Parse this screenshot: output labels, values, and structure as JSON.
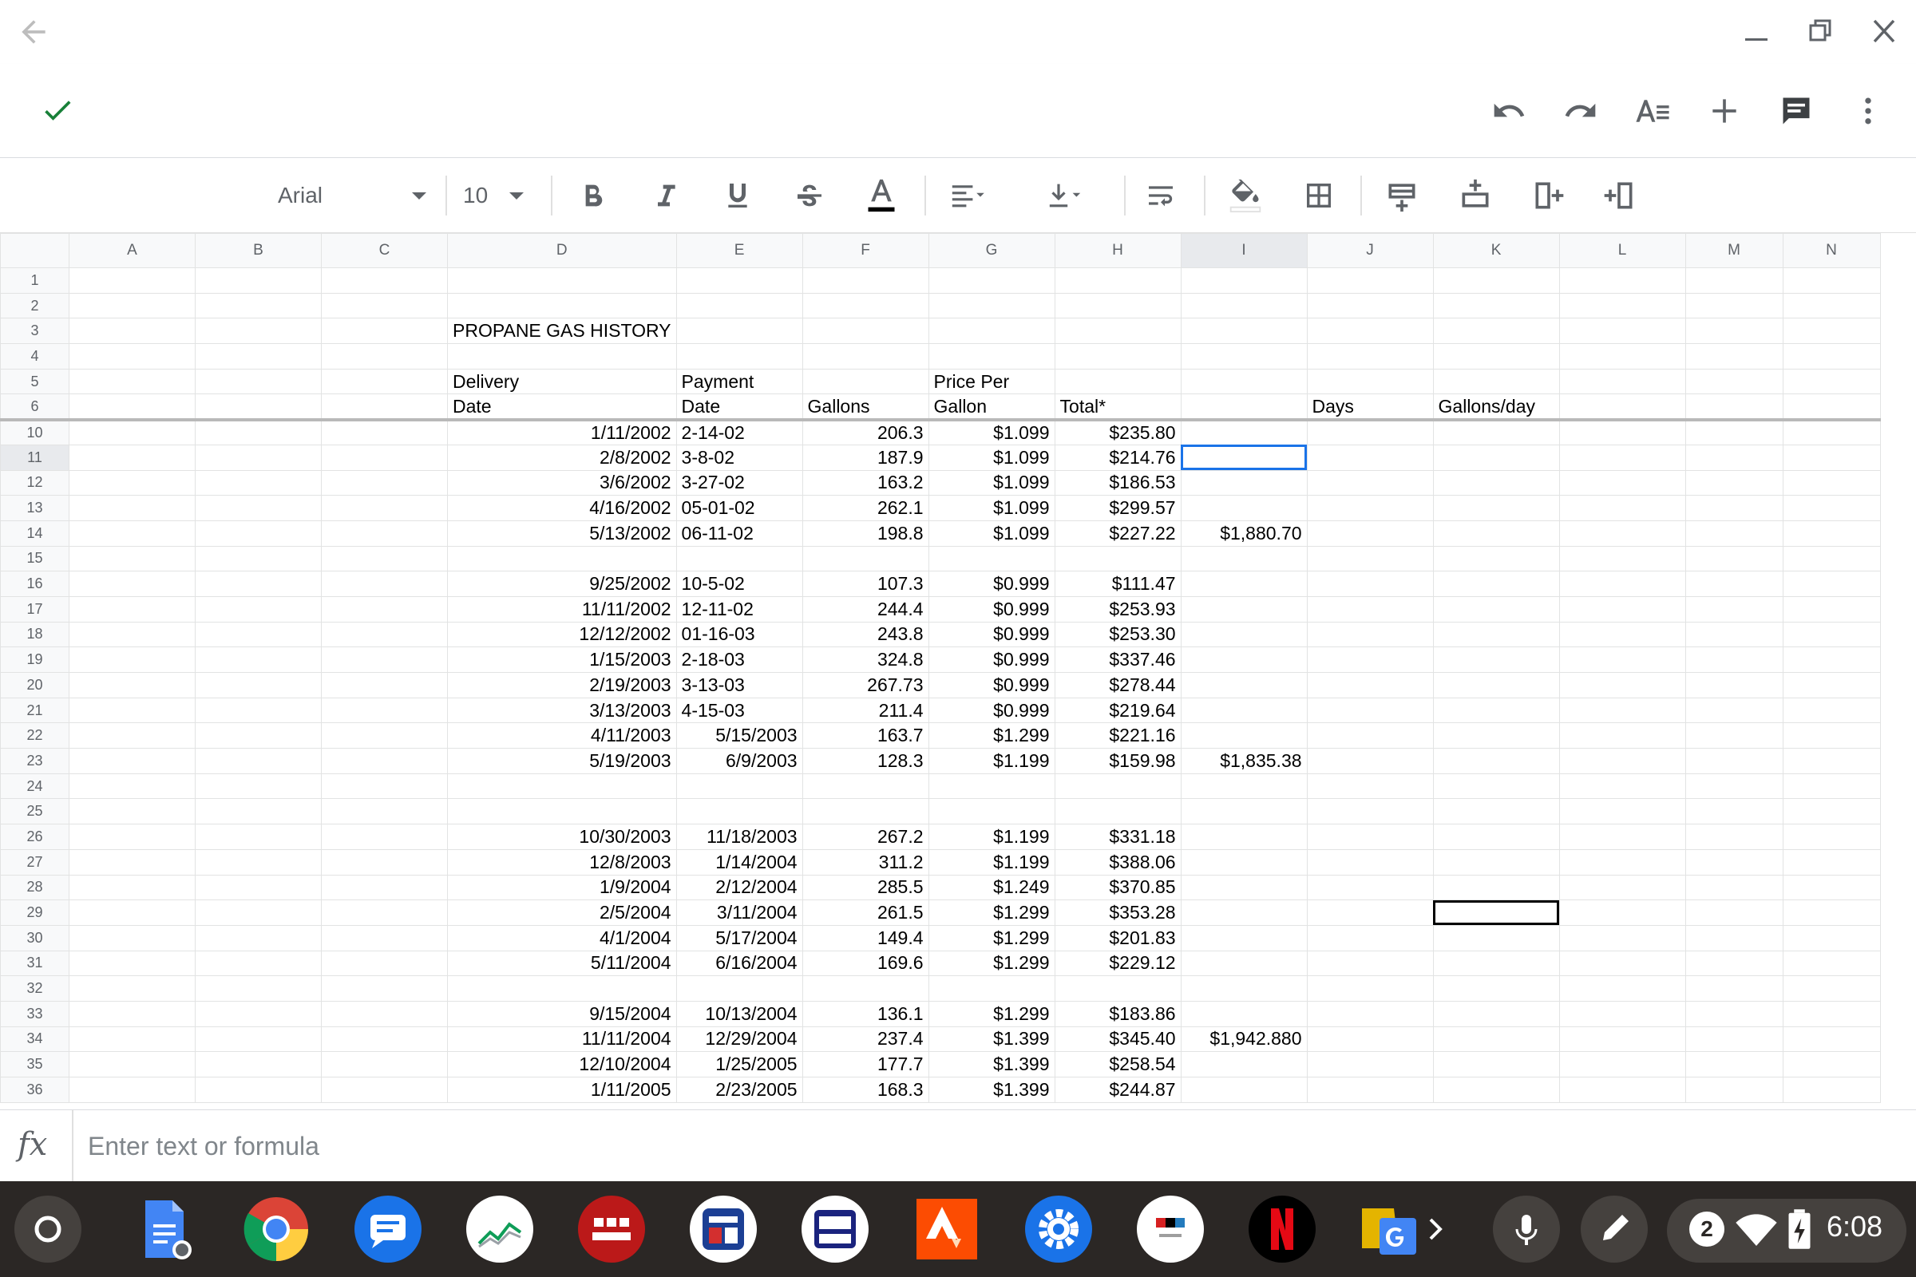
{
  "formula_bar": {
    "fx": "fx",
    "placeholder": "Enter text or formula"
  },
  "format_toolbar": {
    "font": "Arial",
    "size": "10"
  },
  "shelf": {
    "notification_count": "2",
    "time": "6:08"
  },
  "colors": {
    "accent_blue": "#1a73e8",
    "check_green": "#188038",
    "shelf_bg": "#2b2725"
  },
  "sheet": {
    "columns": [
      "A",
      "B",
      "C",
      "D",
      "E",
      "F",
      "G",
      "H",
      "I",
      "J",
      "K",
      "L",
      "M",
      "N"
    ],
    "selected_column": "I",
    "rows": [
      {
        "n": "1",
        "c": {}
      },
      {
        "n": "2",
        "c": {}
      },
      {
        "n": "3",
        "c": {
          "D": "PROPANE GAS HISTORY"
        }
      },
      {
        "n": "4",
        "c": {}
      },
      {
        "n": "5",
        "c": {
          "D": "Delivery",
          "E": "Payment",
          "G": "Price Per"
        }
      },
      {
        "n": "6",
        "c": {
          "D": "Date",
          "E": "Date",
          "F": "Gallons",
          "G": "Gallon",
          "H": "Total*",
          "J": "Days",
          "K": "Gallons/day"
        }
      },
      {
        "n": "10",
        "c": {
          "D": "1/11/2002",
          "E": "2-14-02",
          "F": "206.3",
          "G": "$1.099",
          "H": "$235.80"
        }
      },
      {
        "n": "11",
        "c": {
          "D": "2/8/2002",
          "E": "3-8-02",
          "F": "187.9",
          "G": "$1.099",
          "H": "$214.76"
        }
      },
      {
        "n": "12",
        "c": {
          "D": "3/6/2002",
          "E": "3-27-02",
          "F": "163.2",
          "G": "$1.099",
          "H": "$186.53"
        }
      },
      {
        "n": "13",
        "c": {
          "D": "4/16/2002",
          "E": "05-01-02",
          "F": "262.1",
          "G": "$1.099",
          "H": "$299.57"
        }
      },
      {
        "n": "14",
        "c": {
          "D": "5/13/2002",
          "E": "06-11-02",
          "F": "198.8",
          "G": "$1.099",
          "H": "$227.22",
          "I": "$1,880.70"
        }
      },
      {
        "n": "15",
        "c": {}
      },
      {
        "n": "16",
        "c": {
          "D": "9/25/2002",
          "E": "10-5-02",
          "F": "107.3",
          "G": "$0.999",
          "H": "$111.47"
        }
      },
      {
        "n": "17",
        "c": {
          "D": "11/11/2002",
          "E": "12-11-02",
          "F": "244.4",
          "G": "$0.999",
          "H": "$253.93"
        }
      },
      {
        "n": "18",
        "c": {
          "D": "12/12/2002",
          "E": "01-16-03",
          "F": "243.8",
          "G": "$0.999",
          "H": "$253.30"
        }
      },
      {
        "n": "19",
        "c": {
          "D": "1/15/2003",
          "E": "2-18-03",
          "F": "324.8",
          "G": "$0.999",
          "H": "$337.46"
        }
      },
      {
        "n": "20",
        "c": {
          "D": "2/19/2003",
          "E": "3-13-03",
          "F": "267.73",
          "G": "$0.999",
          "H": "$278.44"
        }
      },
      {
        "n": "21",
        "c": {
          "D": "3/13/2003",
          "E": "4-15-03",
          "F": "211.4",
          "G": "$0.999",
          "H": "$219.64"
        }
      },
      {
        "n": "22",
        "c": {
          "D": "4/11/2003",
          "E": "5/15/2003",
          "F": "163.7",
          "G": "$1.299",
          "H": "$221.16"
        }
      },
      {
        "n": "23",
        "c": {
          "D": "5/19/2003",
          "E": "6/9/2003",
          "F": "128.3",
          "G": "$1.199",
          "H": "$159.98",
          "I": "$1,835.38"
        }
      },
      {
        "n": "24",
        "c": {}
      },
      {
        "n": "25",
        "c": {}
      },
      {
        "n": "26",
        "c": {
          "D": "10/30/2003",
          "E": "11/18/2003",
          "F": "267.2",
          "G": "$1.199",
          "H": "$331.18"
        }
      },
      {
        "n": "27",
        "c": {
          "D": "12/8/2003",
          "E": "1/14/2004",
          "F": "311.2",
          "G": "$1.199",
          "H": "$388.06"
        }
      },
      {
        "n": "28",
        "c": {
          "D": "1/9/2004",
          "E": "2/12/2004",
          "F": "285.5",
          "G": "$1.249",
          "H": "$370.85"
        }
      },
      {
        "n": "29",
        "c": {
          "D": "2/5/2004",
          "E": "3/11/2004",
          "F": "261.5",
          "G": "$1.299",
          "H": "$353.28"
        }
      },
      {
        "n": "30",
        "c": {
          "D": "4/1/2004",
          "E": "5/17/2004",
          "F": "149.4",
          "G": "$1.299",
          "H": "$201.83"
        }
      },
      {
        "n": "31",
        "c": {
          "D": "5/11/2004",
          "E": "6/16/2004",
          "F": "169.6",
          "G": "$1.299",
          "H": "$229.12"
        }
      },
      {
        "n": "32",
        "c": {}
      },
      {
        "n": "33",
        "c": {
          "D": "9/15/2004",
          "E": "10/13/2004",
          "F": "136.1",
          "G": "$1.299",
          "H": "$183.86"
        }
      },
      {
        "n": "34",
        "c": {
          "D": "11/11/2004",
          "E": "12/29/2004",
          "F": "237.4",
          "G": "$1.399",
          "H": "$345.40",
          "I": "$1,942.880"
        }
      },
      {
        "n": "35",
        "c": {
          "D": "12/10/2004",
          "E": "1/25/2005",
          "F": "177.7",
          "G": "$1.399",
          "H": "$258.54"
        }
      },
      {
        "n": "36",
        "c": {
          "D": "1/11/2005",
          "E": "2/23/2005",
          "F": "168.3",
          "G": "$1.399",
          "H": "$244.87"
        }
      }
    ]
  }
}
